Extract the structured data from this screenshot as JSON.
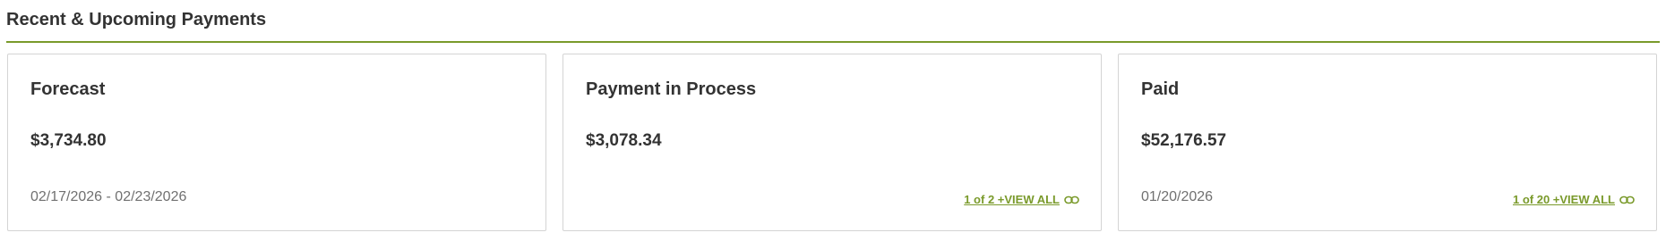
{
  "section": {
    "title": "Recent & Upcoming Payments"
  },
  "colors": {
    "accent": "#7a9a2b",
    "text": "#333333",
    "muted": "#707070",
    "border": "#d4d4d4"
  },
  "cards": [
    {
      "title": "Forecast",
      "amount": "$3,734.80",
      "date": "02/17/2026 - 02/23/2026"
    },
    {
      "title": "Payment in Process",
      "amount": "$3,078.34",
      "link": {
        "label": "1 of 2 +VIEW ALL",
        "icon": "link-icon"
      }
    },
    {
      "title": "Paid",
      "amount": "$52,176.57",
      "date": "01/20/2026",
      "link": {
        "label": "1 of 20 +VIEW ALL",
        "icon": "link-icon"
      }
    }
  ]
}
